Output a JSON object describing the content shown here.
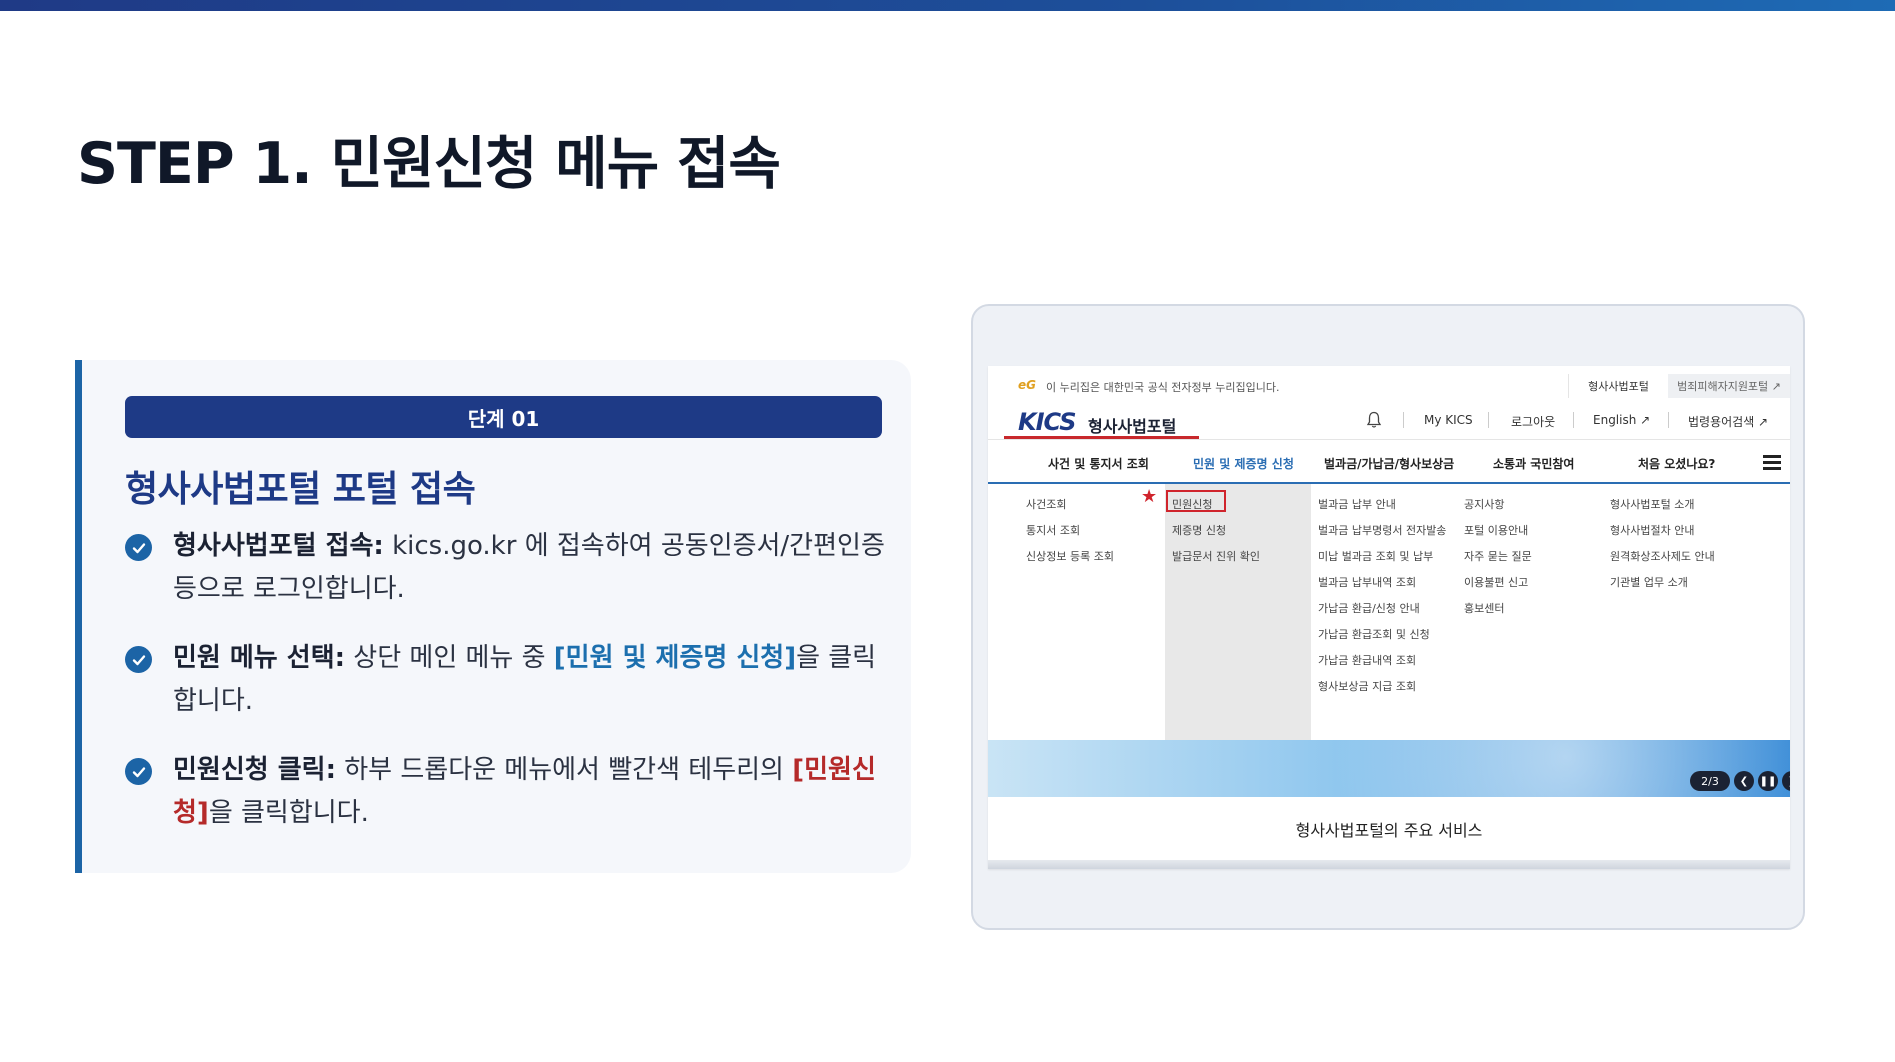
{
  "page": {
    "title": "STEP 1. 민원신청 메뉴 접속"
  },
  "step_card": {
    "badge": "단계 01",
    "heading": "형사사법포털 포털 접속",
    "bullets": [
      {
        "label": "형사사법포털 접속:",
        "text": " kics.go.kr 에 접속하여 공동인증서/간편인증 등으로 로그인합니다."
      },
      {
        "label": "민원 메뉴 선택:",
        "text_before": " 상단 메인 메뉴 중 ",
        "highlight": "[민원 및 제증명 신청]",
        "text_after": "을 클릭합니다."
      },
      {
        "label": "민원신청 클릭:",
        "text_before": " 하부 드롭다운 메뉴에서 빨간색 테두리의 ",
        "highlight": "[민원신청]",
        "text_after": "을 클릭합니다."
      }
    ]
  },
  "screenshot": {
    "gov_bar": {
      "eg": "eG",
      "text": "이 누리집은 대한민국 공식 전자정부 누리집입니다.",
      "link1": "형사사법포털",
      "link2": "범죄피해자지원포털 ↗"
    },
    "logo": "KICS",
    "logo_name": "형사사법포털",
    "util_links": [
      "My KICS",
      "로그아웃",
      "English ↗",
      "법령용어검색 ↗"
    ],
    "gnb": [
      "사건 및 통지서 조회",
      "민원 및 제증명 신청",
      "벌과금/가납금/형사보상금",
      "소통과 국민참여",
      "처음 오셨나요?"
    ],
    "dropdown": {
      "col1": [
        "사건조회",
        "통지서 조회",
        "신상정보 등록 조회"
      ],
      "col2": [
        "민원신청",
        "제증명 신청",
        "발급문서 진위 확인"
      ],
      "col3": [
        "벌과금 납부 안내",
        "벌과금 납부명령서 전자발송",
        "미납 벌과금 조회 및 납부",
        "벌과금 납부내역 조회",
        "가납금 환급/신청 안내",
        "가납금 환급조회 및 신청",
        "가납금 환급내역 조회",
        "형사보상금 지급 조회"
      ],
      "col4": [
        "공지사항",
        "포털 이용안내",
        "자주 묻는 질문",
        "이용불편 신고",
        "홍보센터"
      ],
      "col5": [
        "형사사법포털 소개",
        "형사사법절차 안내",
        "원격화상조사제도 안내",
        "기관별 업무 소개"
      ]
    },
    "banner_pager": "2/3",
    "services_title": "형사사법포털의 주요 서비스"
  },
  "colors": {
    "accent_navy": "#1e3a86",
    "accent_blue": "#1c64a6",
    "highlight_red": "#b52a2a"
  }
}
